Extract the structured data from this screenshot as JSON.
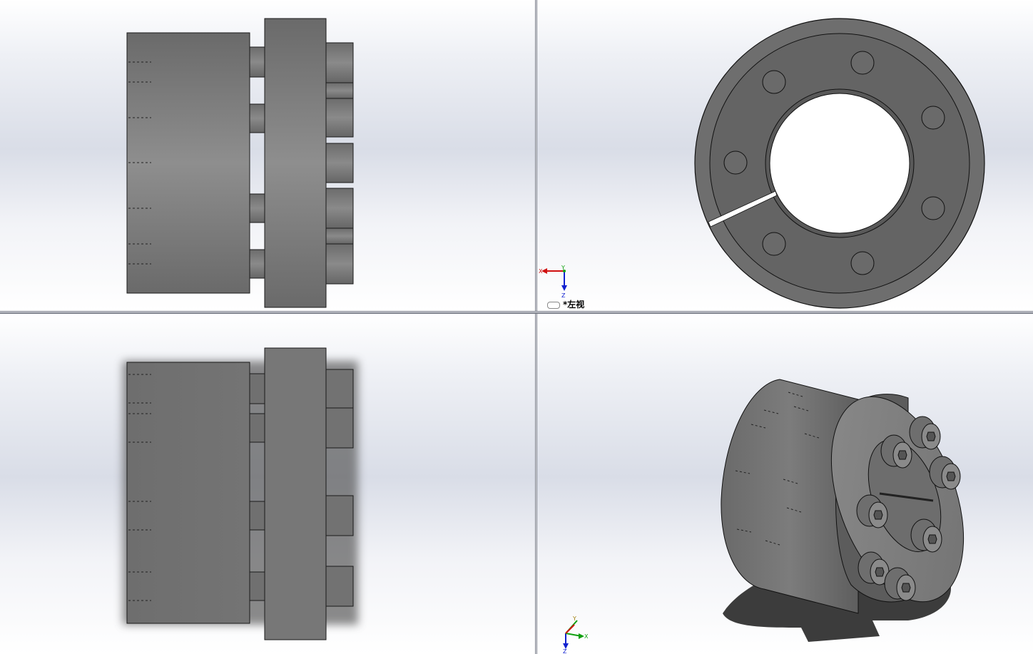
{
  "viewports": {
    "top_left": {
      "name": "front-view"
    },
    "top_right": {
      "name": "left-view",
      "label": "*左视",
      "triad": {
        "x": "X",
        "y": "Y",
        "z": "Z"
      }
    },
    "bottom_left": {
      "name": "top-view"
    },
    "bottom_right": {
      "name": "isometric-view",
      "triad": {
        "x": "X",
        "y": "Y",
        "z": "Z"
      }
    }
  },
  "colors": {
    "part_body": "#727272",
    "part_highlight": "#8c8c8c",
    "edge": "#1a1a1a",
    "shadow": "#3c3c3c",
    "triad_x": "#d01010",
    "triad_y": "#10a010",
    "triad_z": "#1020d0"
  },
  "model": {
    "type": "locking-assembly",
    "bolt_count": 8,
    "icons": [
      "hex-socket-bolt-icon",
      "slit-ring-icon"
    ]
  }
}
